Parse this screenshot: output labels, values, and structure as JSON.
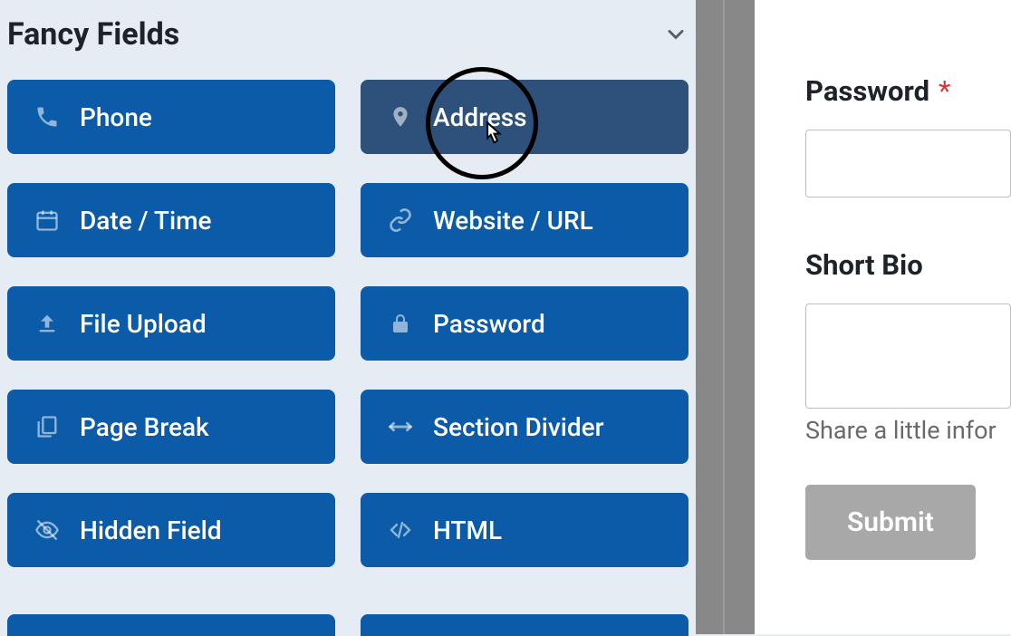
{
  "panel": {
    "title": "Fancy Fields"
  },
  "fields": [
    {
      "label": "Phone",
      "icon": "phone"
    },
    {
      "label": "Address",
      "icon": "pin"
    },
    {
      "label": "Date / Time",
      "icon": "calendar"
    },
    {
      "label": "Website / URL",
      "icon": "link"
    },
    {
      "label": "File Upload",
      "icon": "upload"
    },
    {
      "label": "Password",
      "icon": "lock"
    },
    {
      "label": "Page Break",
      "icon": "pages"
    },
    {
      "label": "Section Divider",
      "icon": "arrows"
    },
    {
      "label": "Hidden Field",
      "icon": "eyeoff"
    },
    {
      "label": "HTML",
      "icon": "code"
    }
  ],
  "form": {
    "password_label": "Password",
    "required_mark": "*",
    "bio_label": "Short Bio",
    "bio_hint": "Share a little infor",
    "submit_label": "Submit"
  }
}
